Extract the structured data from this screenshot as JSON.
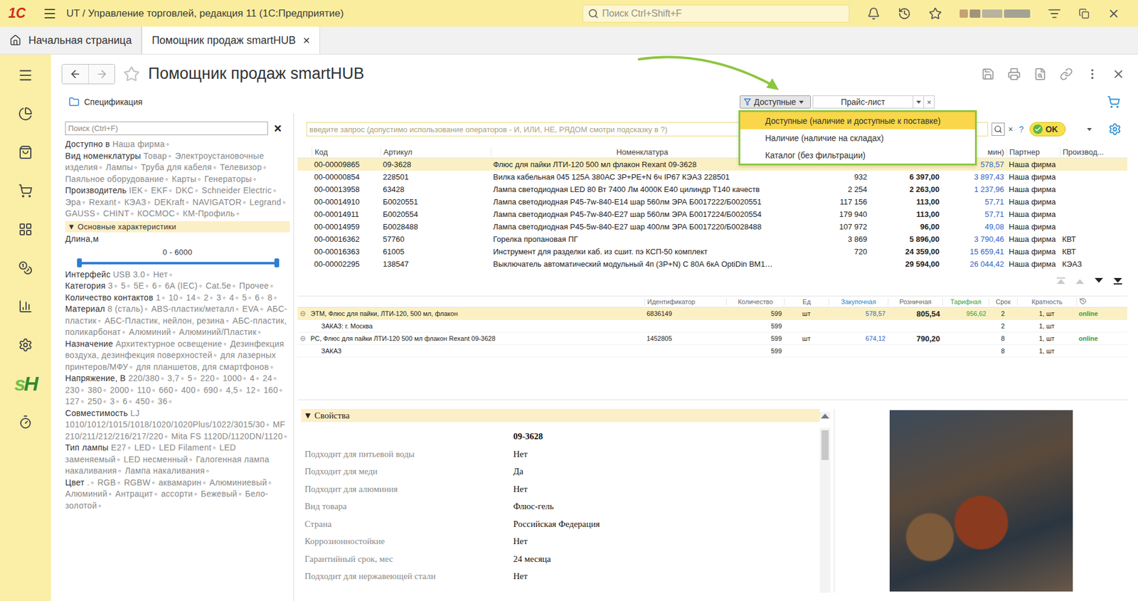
{
  "window": {
    "logo": "1С",
    "title": "UT / Управление торговлей, редакция 11  (1С:Предприятие)",
    "search_placeholder": "Поиск Ctrl+Shift+F"
  },
  "tabs": [
    {
      "label": "Начальная страница",
      "selected": false,
      "closable": false
    },
    {
      "label": "Помощник продаж smartHUB",
      "selected": true,
      "closable": true
    }
  ],
  "tab_close": "×",
  "sidebar": {
    "logo": [
      "s",
      "H"
    ]
  },
  "page": {
    "title": "Помощник продаж smartHUB",
    "spec_link": "Спецификация"
  },
  "filter": {
    "button": "Доступные",
    "price_field": "Прайс-лист",
    "clear": "×",
    "menu_open": true,
    "menu": [
      {
        "label": "Доступные (наличие и доступные к поставке)",
        "selected": true
      },
      {
        "label": "Наличие (наличие на складах)",
        "selected": false
      },
      {
        "label": "Каталог (без фильтрации)",
        "selected": false
      }
    ]
  },
  "facets": {
    "search_placeholder": "Поиск (Ctrl+F)",
    "clear": "×",
    "separator": "◦",
    "groups": [
      {
        "label": "Доступно в",
        "values": [
          "Наша фирма"
        ]
      },
      {
        "label": "Вид номенклатуры",
        "values": [
          "Товар",
          "Электроустановочные изделия",
          "Лампы",
          "Труба для кабеля",
          "Телевизор",
          "Паяльное оборудование",
          "Карты",
          "Генераторы"
        ]
      },
      {
        "label": "Производитель",
        "values": [
          "IEK",
          "EKF",
          "DKC",
          "Schneider Electric",
          "Эра",
          "Rexant",
          "КЭАЗ",
          "DEKraft",
          "NAVIGATOR",
          "Legrand",
          "GAUSS",
          "CHINT",
          "КОСМОС",
          "КМ-Профиль"
        ]
      }
    ],
    "section": {
      "marker": "▼",
      "label": "Основные характеристики",
      "expanded": true
    },
    "slider": {
      "label": "Длина,м",
      "reading": "0 - 6000",
      "low": 0,
      "high": 1
    },
    "section_groups": [
      {
        "label": "Интерфейс",
        "values": [
          "USB 3.0",
          "Нет"
        ]
      },
      {
        "label": "Категория",
        "values": [
          "3",
          "5",
          "5E",
          "6",
          "6A (IEC)",
          "Cat.5e",
          "Прочее"
        ]
      },
      {
        "label": "Количество контактов",
        "values": [
          "1",
          "10",
          "14",
          "2",
          "3",
          "4",
          "5",
          "6",
          "8"
        ]
      },
      {
        "label": "Материал",
        "values": [
          "8 (сталь)",
          "ABS-пластик/металл",
          "EVA",
          "АБС-пластик",
          "АБС-Пластик, нейлон, резина",
          "АБС-пластик, поликарбонат",
          "Алюминий",
          "Алюминий/Пластик"
        ]
      },
      {
        "label": "Назначение",
        "values": [
          "Архитектурное освещение",
          "Дезинфекция воздуха, дезинфекция поверхностей",
          "для лазерных принтеров/МФУ",
          "для планшетов, для смартфонов"
        ]
      },
      {
        "label": "Напряжение, В",
        "values": [
          "220/380",
          "3,7",
          "5",
          "220",
          "1000",
          "4",
          "24",
          "230",
          "380",
          "2000",
          "110",
          "660",
          "400",
          "690",
          "4,5",
          "12",
          "160",
          "127",
          "250",
          "3",
          "6",
          "450",
          "36"
        ]
      },
      {
        "label": "Совместимость",
        "values": [
          "LJ 1010/1012/1015/1018/1020/1020Plus/1022/3015/30",
          "MF 210/211/212/216/217/220",
          "Mita FS 1120D/1120DN/1120"
        ]
      },
      {
        "label": "Тип лампы",
        "values": [
          "E27",
          "LED",
          "LED Filament",
          "LED заменяемый",
          "LED несменный",
          "Галогенная лампа накаливания",
          "Лампа накаливания"
        ]
      },
      {
        "label": "Цвет",
        "values": [
          ".",
          "RGB",
          "RGBW",
          "аквамарин",
          "Алюминиевый",
          "Алюминий",
          "Антрацит",
          "ассорти",
          "Бежевый",
          "Бело-золотой"
        ]
      }
    ]
  },
  "query": {
    "placeholder": "введите запрос (допустимо использование операторов - И, ИЛИ, НЕ, РЯДОМ смотри подсказку в ?)",
    "clear": "×",
    "help": "?",
    "ok": "OK"
  },
  "table": {
    "columns": [
      "Код",
      "Артикул",
      "Номенклатура",
      "",
      "",
      "мин)",
      "Партнер",
      "Производ..."
    ],
    "rows": [
      {
        "code": "00-00009865",
        "article": "09-3628",
        "name": "Флюс для пайки ЛТИ-120 500 мл флакон Rexant 09-3628",
        "qty": "",
        "price": "",
        "min_price": "578,57",
        "partner": "Наша фирма",
        "maker": "",
        "selected": true
      },
      {
        "code": "00-00000854",
        "article": "228501",
        "name": "Вилка кабельная 045 125А 380АС 3Р+РЕ+N 6ч IP67 КЭАЗ 228501",
        "qty": "932",
        "price": "6 397,00",
        "min_price": "3 897,43",
        "partner": "Наша фирма",
        "maker": "",
        "selected": false
      },
      {
        "code": "00-00013958",
        "article": "63428",
        "name": "Лампа светодиодная LED 80 Вт 7400 Лм 4000К E40 цилиндр T140 качеств",
        "qty": "2 254",
        "price": "2 263,00",
        "min_price": "1 237,96",
        "partner": "Наша фирма",
        "maker": "",
        "selected": false
      },
      {
        "code": "00-00014910",
        "article": "Б0020551",
        "name": "Лампа светодиодная Р45-7w-840-E14 шар 560лм ЭРА Б0017222/Б0020551",
        "qty": "117 156",
        "price": "113,00",
        "min_price": "57,71",
        "partner": "Наша фирма",
        "maker": "",
        "selected": false
      },
      {
        "code": "00-00014911",
        "article": "Б0020554",
        "name": "Лампа светодиодная Р45-7w-840-E27 шар 560лм ЭРА Б0017224/Б0020554",
        "qty": "179 940",
        "price": "113,00",
        "min_price": "57,71",
        "partner": "Наша фирма",
        "maker": "",
        "selected": false
      },
      {
        "code": "00-00014959",
        "article": "Б0028488",
        "name": "Лампа светодиодная Р45-5w-840-E27 шар 400лм ЭРА Б0017220/Б0028488",
        "qty": "107 972",
        "price": "96,00",
        "min_price": "49,08",
        "partner": "Наша фирма",
        "maker": "",
        "selected": false
      },
      {
        "code": "00-00016362",
        "article": "57760",
        "name": "Горелка пропановая ПГ",
        "qty": "3 869",
        "price": "5 896,00",
        "min_price": "3 790,46",
        "partner": "Наша фирма",
        "maker": "КВТ",
        "selected": false
      },
      {
        "code": "00-00016363",
        "article": "61005",
        "name": "Инструмент для разделки каб. из сшит. пэ КСП-50 комплект",
        "qty": "720",
        "price": "24 359,00",
        "min_price": "15 659,41",
        "partner": "Наша фирма",
        "maker": "КВТ",
        "selected": false
      },
      {
        "code": "00-00002295",
        "article": "138547",
        "name": "Выключатель автоматический модульный 4п (3Р+N) С 80А 6кА OptiDin ВМ1…",
        "qty": "",
        "price": "29 594,00",
        "min_price": "26 044,42",
        "partner": "Наша фирма",
        "maker": "КЭАЗ",
        "selected": false
      }
    ]
  },
  "offers": {
    "columns": [
      "",
      "Идентификатор",
      "Количество",
      "Ед",
      "Закупочная",
      "Розничная",
      "Тарифная",
      "Срок",
      "Кратность"
    ],
    "rows": [
      {
        "kind": "group",
        "expanded": true,
        "selected": true,
        "marker": "⊖",
        "name": "ЭТМ, Флюс для пайки, ЛТИ-120, 500 мл, флакон",
        "id": "6836149",
        "qty": "599",
        "unit": "шт",
        "purchase": "578,57",
        "retail": "805,54",
        "tariff": "956,62",
        "term": "2",
        "multiplicity": "1, шт",
        "status": "online"
      },
      {
        "kind": "order",
        "selected": false,
        "marker": "",
        "name": "ЗАКАЗ: г. Москва",
        "id": "",
        "qty": "599",
        "unit": "",
        "purchase": "",
        "retail": "",
        "tariff": "",
        "term": "2",
        "multiplicity": "1, шт",
        "status": ""
      },
      {
        "kind": "group",
        "expanded": true,
        "selected": false,
        "marker": "⊖",
        "name": "РС, Флюс для пайки ЛТИ-120 500 мл флакон Rexant 09-3628",
        "id": "1452805",
        "qty": "599",
        "unit": "шт",
        "purchase": "674,12",
        "retail": "790,20",
        "tariff": "",
        "term": "8",
        "multiplicity": "1, шт",
        "status": "online"
      },
      {
        "kind": "order",
        "selected": false,
        "marker": "",
        "name": "ЗАКАЗ",
        "id": "",
        "qty": "599",
        "unit": "",
        "purchase": "",
        "retail": "",
        "tariff": "",
        "term": "8",
        "multiplicity": "1, шт",
        "status": ""
      }
    ]
  },
  "properties": {
    "marker": "▼",
    "title": "Свойства",
    "expanded": true,
    "heading": "09-3628",
    "items": [
      {
        "label": "Подходит для питьевой воды",
        "value": "Нет"
      },
      {
        "label": "Подходит для меди",
        "value": "Да"
      },
      {
        "label": "Подходит для алюминия",
        "value": "Нет"
      },
      {
        "label": "Вид товара",
        "value": "Флюс-гель"
      },
      {
        "label": "Страна",
        "value": "Российская Федерация"
      },
      {
        "label": "Коррозионностойкие",
        "value": "Нет"
      },
      {
        "label": "Гарантийный срок, мес",
        "value": "24 месяца"
      },
      {
        "label": "Подходит для нержавеющей стали",
        "value": "Нет"
      }
    ]
  }
}
